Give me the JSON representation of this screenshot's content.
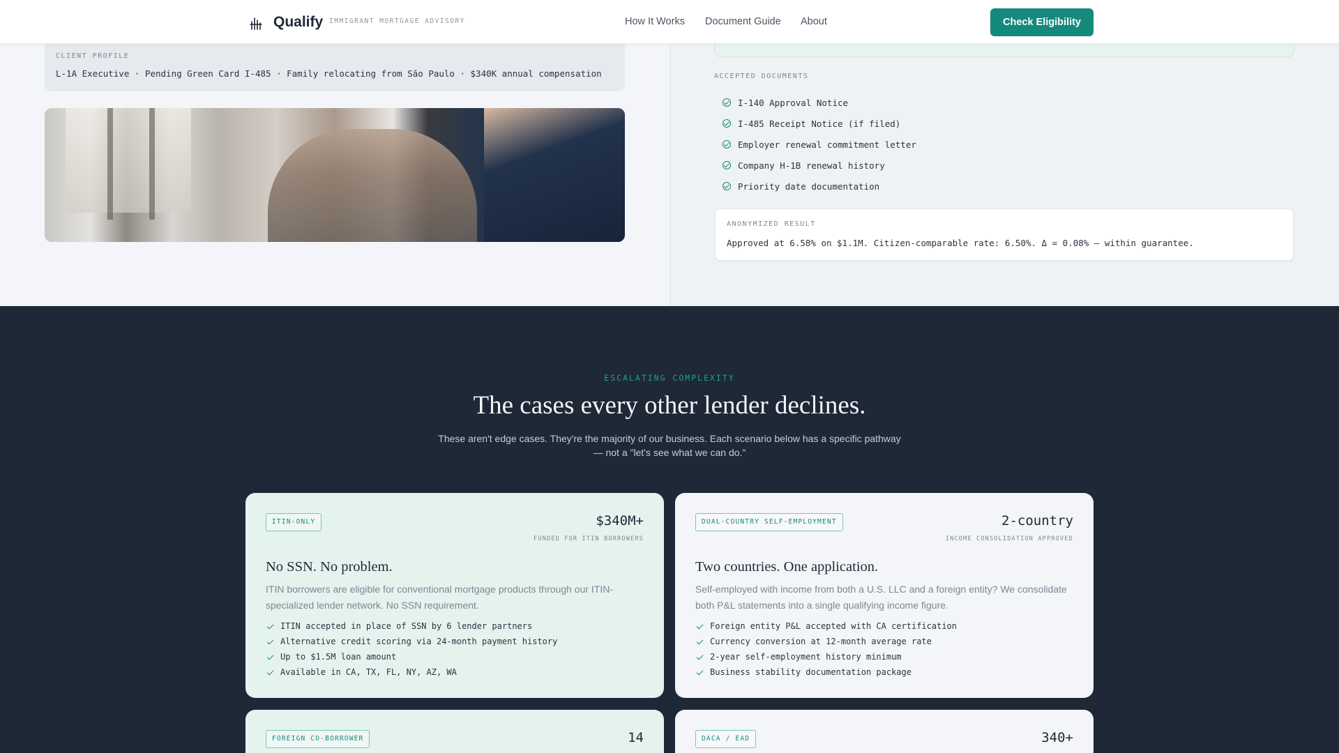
{
  "header": {
    "brand": "Qualify",
    "tagline": "IMMIGRANT MORTGAGE ADVISORY",
    "nav": [
      "How It Works",
      "Document Guide",
      "About"
    ],
    "cta": "Check Eligibility",
    "accent_color": "#138a7c"
  },
  "case_study": {
    "profile_label": "CLIENT PROFILE",
    "profile_text": "L-1A Executive · Pending Green Card I-485 · Family relocating from São Paulo · $340K annual compensation",
    "accepted_label": "ACCEPTED DOCUMENTS",
    "documents": [
      "I-140 Approval Notice",
      "I-485 Receipt Notice (if filed)",
      "Employer renewal commitment letter",
      "Company H-1B renewal history",
      "Priority date documentation"
    ],
    "result_label": "ANONYMIZED RESULT",
    "result_text": "Approved at 6.58% on $1.1M. Citizen-comparable rate: 6.50%. Δ = 0.08% — within guarantee."
  },
  "complexity": {
    "eyebrow": "ESCALATING COMPLEXITY",
    "headline": "The cases every other lender declines.",
    "intro": "These aren't edge cases. They're the majority of our business. Each scenario below has a specific pathway — not a \"let's see what we can do.\"",
    "cards": [
      {
        "tag": "ITIN-ONLY",
        "stat": "$340M+",
        "stat_sub": "FUNDED FOR ITIN BORROWERS",
        "title": "No SSN. No problem.",
        "desc": "ITIN borrowers are eligible for conventional mortgage products through our ITIN-specialized lender network. No SSN requirement.",
        "points": [
          "ITIN accepted in place of SSN by 6 lender partners",
          "Alternative credit scoring via 24-month payment history",
          "Up to $1.5M loan amount",
          "Available in CA, TX, FL, NY, AZ, WA"
        ]
      },
      {
        "tag": "DUAL-COUNTRY SELF-EMPLOYMENT",
        "stat": "2-country",
        "stat_sub": "INCOME CONSOLIDATION APPROVED",
        "title": "Two countries. One application.",
        "desc": "Self-employed with income from both a U.S. LLC and a foreign entity? We consolidate both P&L statements into a single qualifying income figure.",
        "points": [
          "Foreign entity P&L accepted with CA certification",
          "Currency conversion at 12-month average rate",
          "2-year self-employment history minimum",
          "Business stability documentation package"
        ]
      },
      {
        "tag": "FOREIGN CO-BORROWER",
        "stat": "14"
      },
      {
        "tag": "DACA / EAD",
        "stat": "340+"
      }
    ]
  }
}
